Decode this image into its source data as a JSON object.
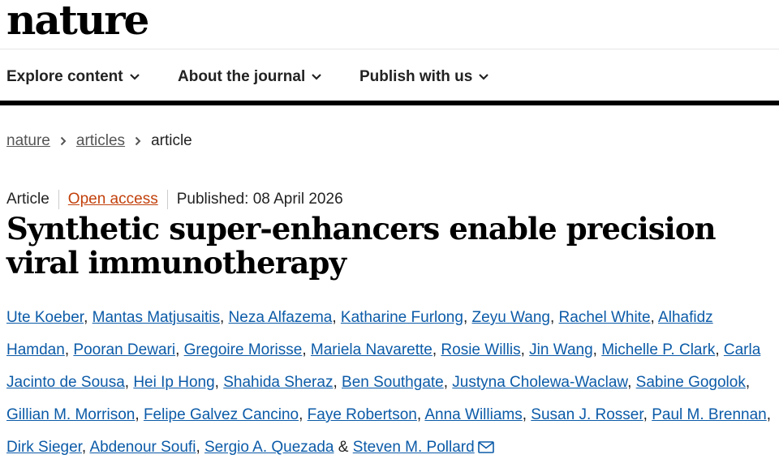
{
  "brand": {
    "logo": "nature"
  },
  "nav": {
    "items": [
      {
        "label": "Explore content"
      },
      {
        "label": "About the journal"
      },
      {
        "label": "Publish with us"
      }
    ]
  },
  "breadcrumb": {
    "items": [
      "nature",
      "articles"
    ],
    "current": "article"
  },
  "article": {
    "type": "Article",
    "access": "Open access",
    "published": "Published: 08 April 2026",
    "title": "Synthetic super-enhancers enable precision viral immunotherapy",
    "authors": [
      "Ute Koeber",
      "Mantas Matjusaitis",
      "Neza Alfazema",
      "Katharine Furlong",
      "Zeyu Wang",
      "Rachel White",
      "Alhafidz Hamdan",
      "Pooran Dewari",
      "Gregoire Morisse",
      "Mariela Navarette",
      "Rosie Willis",
      "Jin Wang",
      "Michelle P. Clark",
      "Carla Jacinto de Sousa",
      "Hei Ip Hong",
      "Shahida Sheraz",
      "Ben Southgate",
      "Justyna Cholewa-Waclaw",
      "Sabine Gogolok",
      "Gillian M. Morrison",
      "Felipe Galvez Cancino",
      "Faye Robertson",
      "Anna Williams",
      "Susan J. Rosser",
      "Paul M. Brennan",
      "Dirk Sieger",
      "Abdenour Soufi",
      "Sergio A. Quezada",
      "Steven M. Pollard"
    ],
    "author_separator": ", ",
    "last_author_conjunction": " & "
  },
  "colors": {
    "link": "#0c5ba8",
    "open_access": "#c2410c",
    "nav_rule": "#000000"
  },
  "icons": {
    "nav_chevron": "chevron-down-icon",
    "breadcrumb_separator": "chevron-right-icon",
    "author_contact": "mail-icon"
  }
}
